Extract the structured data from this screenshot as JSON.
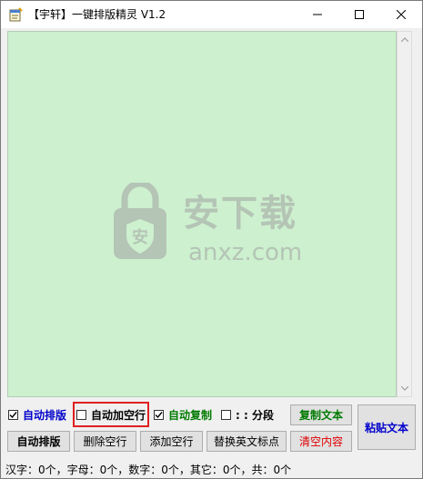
{
  "window": {
    "title": "【宇轩】一键排版精灵 V1.2"
  },
  "watermark": {
    "text": "安下载",
    "sub": "anxz.com"
  },
  "options": {
    "auto_layout": {
      "label": "自动排版",
      "checked": true,
      "color": "#0000cc"
    },
    "auto_blank_line": {
      "label": "自动加空行",
      "checked": false,
      "color": "#000000"
    },
    "auto_copy": {
      "label": "自动复制",
      "checked": true,
      "color": "#007a00"
    },
    "paragraph": {
      "label": ": : 分段",
      "checked": false,
      "color": "#000000"
    }
  },
  "buttons": {
    "copy_text": {
      "label": "复制文本",
      "color": "#007a00"
    },
    "paste_text": {
      "label": "粘贴文本",
      "color": "#0000cc"
    },
    "auto_layout": {
      "label": "自动排版"
    },
    "delete_blank": {
      "label": "删除空行"
    },
    "add_blank": {
      "label": "添加空行"
    },
    "replace_punct": {
      "label": "替换英文标点"
    },
    "clear_content": {
      "label": "清空内容",
      "color": "#e00000"
    }
  },
  "status": {
    "text": "汉字：0个，字母：0个，数字：0个，其它：0个，共：0个"
  }
}
